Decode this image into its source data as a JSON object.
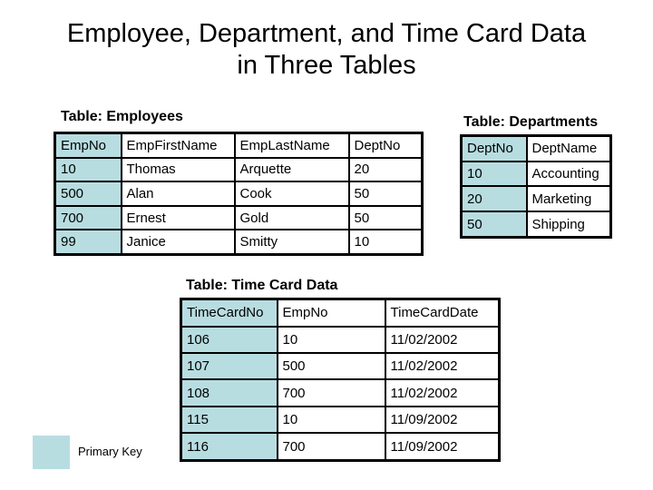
{
  "title_line1": "Employee, Department, and Time Card Data",
  "title_line2": "in Three Tables",
  "colors": {
    "primary_key": "#b8dde1",
    "border": "#000000",
    "background": "#ffffff"
  },
  "employees": {
    "label": "Table: Employees",
    "headers": [
      "EmpNo",
      "EmpFirstName",
      "EmpLastName",
      "DeptNo"
    ],
    "primary_key": "EmpNo",
    "rows": [
      [
        "10",
        "Thomas",
        "Arquette",
        "20"
      ],
      [
        "500",
        "Alan",
        "Cook",
        "50"
      ],
      [
        "700",
        "Ernest",
        "Gold",
        "50"
      ],
      [
        "99",
        "Janice",
        "Smitty",
        "10"
      ]
    ]
  },
  "departments": {
    "label": "Table: Departments",
    "headers": [
      "DeptNo",
      "DeptName"
    ],
    "primary_key": "DeptNo",
    "rows": [
      [
        "10",
        "Accounting"
      ],
      [
        "20",
        "Marketing"
      ],
      [
        "50",
        "Shipping"
      ]
    ]
  },
  "timecards": {
    "label": "Table: Time Card Data",
    "headers": [
      "TimeCardNo",
      "EmpNo",
      "TimeCardDate"
    ],
    "primary_key": "TimeCardNo",
    "rows": [
      [
        "106",
        "10",
        "11/02/2002"
      ],
      [
        "107",
        "500",
        "11/02/2002"
      ],
      [
        "108",
        "700",
        "11/02/2002"
      ],
      [
        "115",
        "10",
        "11/09/2002"
      ],
      [
        "116",
        "700",
        "11/09/2002"
      ]
    ]
  },
  "legend": {
    "label": "Primary Key"
  }
}
